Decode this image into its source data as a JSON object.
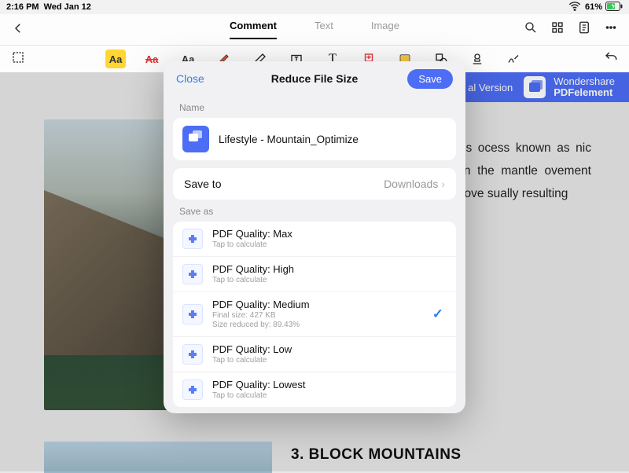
{
  "status": {
    "time": "2:16 PM",
    "date": "Wed Jan 12",
    "battery": "61%"
  },
  "nav": {
    "tabs": [
      "Comment",
      "Text",
      "Image"
    ],
    "active": 0
  },
  "banner": {
    "pre": "al Version",
    "brand1": "Wondershare",
    "brand2": "PDFelement"
  },
  "doc": {
    "body": "s a result of a ates. The plates ocess known as nic plates shift ing below one k in the mantle ovement occurs creating a fold  remain above sually resulting",
    "heading": "3. BLOCK MOUNTAINS"
  },
  "modal": {
    "close": "Close",
    "title": "Reduce File Size",
    "save": "Save",
    "name_label": "Name",
    "filename": "Lifestyle - Mountain_Optimize",
    "saveto_label": "Save to",
    "saveto_value": "Downloads",
    "saveas_label": "Save as",
    "qualities": [
      {
        "title": "PDF Quality: Max",
        "sub": "Tap to calculate",
        "selected": false
      },
      {
        "title": "PDF Quality: High",
        "sub": "Tap to calculate",
        "selected": false
      },
      {
        "title": "PDF Quality: Medium",
        "sub": "Final size: 427 KB\nSize reduced by: 89.43%",
        "selected": true
      },
      {
        "title": "PDF Quality: Low",
        "sub": "Tap to calculate",
        "selected": false
      },
      {
        "title": "PDF Quality: Lowest",
        "sub": "Tap to calculate",
        "selected": false
      }
    ]
  }
}
